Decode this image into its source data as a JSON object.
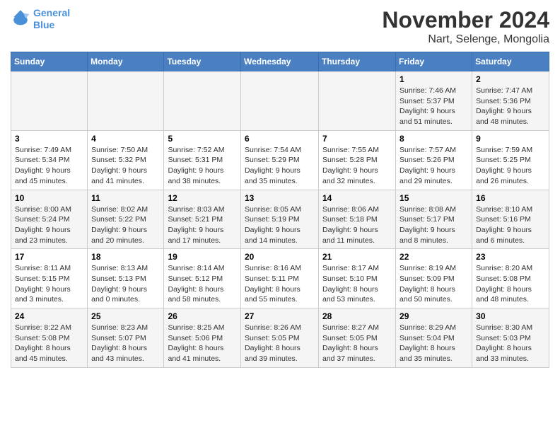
{
  "logo": {
    "line1": "General",
    "line2": "Blue"
  },
  "title": {
    "month_year": "November 2024",
    "location": "Nart, Selenge, Mongolia"
  },
  "days_of_week": [
    "Sunday",
    "Monday",
    "Tuesday",
    "Wednesday",
    "Thursday",
    "Friday",
    "Saturday"
  ],
  "weeks": [
    [
      {
        "num": "",
        "info": ""
      },
      {
        "num": "",
        "info": ""
      },
      {
        "num": "",
        "info": ""
      },
      {
        "num": "",
        "info": ""
      },
      {
        "num": "",
        "info": ""
      },
      {
        "num": "1",
        "info": "Sunrise: 7:46 AM\nSunset: 5:37 PM\nDaylight: 9 hours and 51 minutes."
      },
      {
        "num": "2",
        "info": "Sunrise: 7:47 AM\nSunset: 5:36 PM\nDaylight: 9 hours and 48 minutes."
      }
    ],
    [
      {
        "num": "3",
        "info": "Sunrise: 7:49 AM\nSunset: 5:34 PM\nDaylight: 9 hours and 45 minutes."
      },
      {
        "num": "4",
        "info": "Sunrise: 7:50 AM\nSunset: 5:32 PM\nDaylight: 9 hours and 41 minutes."
      },
      {
        "num": "5",
        "info": "Sunrise: 7:52 AM\nSunset: 5:31 PM\nDaylight: 9 hours and 38 minutes."
      },
      {
        "num": "6",
        "info": "Sunrise: 7:54 AM\nSunset: 5:29 PM\nDaylight: 9 hours and 35 minutes."
      },
      {
        "num": "7",
        "info": "Sunrise: 7:55 AM\nSunset: 5:28 PM\nDaylight: 9 hours and 32 minutes."
      },
      {
        "num": "8",
        "info": "Sunrise: 7:57 AM\nSunset: 5:26 PM\nDaylight: 9 hours and 29 minutes."
      },
      {
        "num": "9",
        "info": "Sunrise: 7:59 AM\nSunset: 5:25 PM\nDaylight: 9 hours and 26 minutes."
      }
    ],
    [
      {
        "num": "10",
        "info": "Sunrise: 8:00 AM\nSunset: 5:24 PM\nDaylight: 9 hours and 23 minutes."
      },
      {
        "num": "11",
        "info": "Sunrise: 8:02 AM\nSunset: 5:22 PM\nDaylight: 9 hours and 20 minutes."
      },
      {
        "num": "12",
        "info": "Sunrise: 8:03 AM\nSunset: 5:21 PM\nDaylight: 9 hours and 17 minutes."
      },
      {
        "num": "13",
        "info": "Sunrise: 8:05 AM\nSunset: 5:19 PM\nDaylight: 9 hours and 14 minutes."
      },
      {
        "num": "14",
        "info": "Sunrise: 8:06 AM\nSunset: 5:18 PM\nDaylight: 9 hours and 11 minutes."
      },
      {
        "num": "15",
        "info": "Sunrise: 8:08 AM\nSunset: 5:17 PM\nDaylight: 9 hours and 8 minutes."
      },
      {
        "num": "16",
        "info": "Sunrise: 8:10 AM\nSunset: 5:16 PM\nDaylight: 9 hours and 6 minutes."
      }
    ],
    [
      {
        "num": "17",
        "info": "Sunrise: 8:11 AM\nSunset: 5:15 PM\nDaylight: 9 hours and 3 minutes."
      },
      {
        "num": "18",
        "info": "Sunrise: 8:13 AM\nSunset: 5:13 PM\nDaylight: 9 hours and 0 minutes."
      },
      {
        "num": "19",
        "info": "Sunrise: 8:14 AM\nSunset: 5:12 PM\nDaylight: 8 hours and 58 minutes."
      },
      {
        "num": "20",
        "info": "Sunrise: 8:16 AM\nSunset: 5:11 PM\nDaylight: 8 hours and 55 minutes."
      },
      {
        "num": "21",
        "info": "Sunrise: 8:17 AM\nSunset: 5:10 PM\nDaylight: 8 hours and 53 minutes."
      },
      {
        "num": "22",
        "info": "Sunrise: 8:19 AM\nSunset: 5:09 PM\nDaylight: 8 hours and 50 minutes."
      },
      {
        "num": "23",
        "info": "Sunrise: 8:20 AM\nSunset: 5:08 PM\nDaylight: 8 hours and 48 minutes."
      }
    ],
    [
      {
        "num": "24",
        "info": "Sunrise: 8:22 AM\nSunset: 5:08 PM\nDaylight: 8 hours and 45 minutes."
      },
      {
        "num": "25",
        "info": "Sunrise: 8:23 AM\nSunset: 5:07 PM\nDaylight: 8 hours and 43 minutes."
      },
      {
        "num": "26",
        "info": "Sunrise: 8:25 AM\nSunset: 5:06 PM\nDaylight: 8 hours and 41 minutes."
      },
      {
        "num": "27",
        "info": "Sunrise: 8:26 AM\nSunset: 5:05 PM\nDaylight: 8 hours and 39 minutes."
      },
      {
        "num": "28",
        "info": "Sunrise: 8:27 AM\nSunset: 5:05 PM\nDaylight: 8 hours and 37 minutes."
      },
      {
        "num": "29",
        "info": "Sunrise: 8:29 AM\nSunset: 5:04 PM\nDaylight: 8 hours and 35 minutes."
      },
      {
        "num": "30",
        "info": "Sunrise: 8:30 AM\nSunset: 5:03 PM\nDaylight: 8 hours and 33 minutes."
      }
    ]
  ]
}
